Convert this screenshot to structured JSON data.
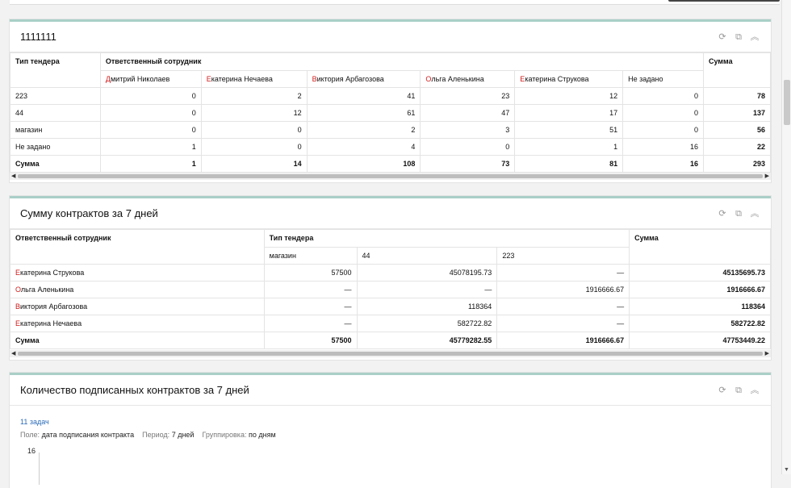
{
  "widget1": {
    "title": "1111111",
    "header": {
      "col1": "Тип тендера",
      "group": "Ответственный сотрудник",
      "sum": "Сумма"
    },
    "employees": [
      {
        "first": "Д",
        "rest": "митрий Николаев"
      },
      {
        "first": "Е",
        "rest": "катерина Нечаева"
      },
      {
        "first": "В",
        "rest": "иктория Арбагозова"
      },
      {
        "first": "О",
        "rest": "льга Аленькина"
      },
      {
        "first": "Е",
        "rest": "катерина Струкова"
      },
      {
        "first": "",
        "rest": "Не задано"
      }
    ],
    "rows": [
      {
        "label": "223",
        "values": [
          "0",
          "2",
          "41",
          "23",
          "12",
          "0"
        ],
        "sum": "78"
      },
      {
        "label": "44",
        "values": [
          "0",
          "12",
          "61",
          "47",
          "17",
          "0"
        ],
        "sum": "137"
      },
      {
        "label": "магазин",
        "values": [
          "0",
          "0",
          "2",
          "3",
          "51",
          "0"
        ],
        "sum": "56"
      },
      {
        "label": "Не задано",
        "values": [
          "1",
          "0",
          "4",
          "0",
          "1",
          "16"
        ],
        "sum": "22"
      },
      {
        "label": "Сумма",
        "values": [
          "1",
          "14",
          "108",
          "73",
          "81",
          "16"
        ],
        "sum": "293"
      }
    ]
  },
  "widget2": {
    "title": "Сумму контрактов за 7 дней",
    "header": {
      "col1": "Ответственный сотрудник",
      "group": "Тип тендера",
      "sum": "Сумма"
    },
    "types": [
      "магазин",
      "44",
      "223"
    ],
    "rows": [
      {
        "first": "Е",
        "rest": "катерина Струкова",
        "values": [
          "57500",
          "45078195.73",
          "—"
        ],
        "sum": "45135695.73"
      },
      {
        "first": "О",
        "rest": "льга Аленькина",
        "values": [
          "—",
          "—",
          "1916666.67"
        ],
        "sum": "1916666.67"
      },
      {
        "first": "В",
        "rest": "иктория Арбагозова",
        "values": [
          "—",
          "118364",
          "—"
        ],
        "sum": "118364"
      },
      {
        "first": "Е",
        "rest": "катерина Нечаева",
        "values": [
          "—",
          "582722.82",
          "—"
        ],
        "sum": "582722.82"
      }
    ],
    "total": {
      "label": "Сумма",
      "values": [
        "57500",
        "45779282.55",
        "1916666.67"
      ],
      "sum": "47753449.22"
    }
  },
  "widget3": {
    "title": "Количество подписанных контрактов за 7 дней",
    "tasks_link": "11 задач",
    "field_label": "Поле:",
    "field_value": "дата подписания контракта",
    "period_label": "Период:",
    "period_value": "7 дней",
    "group_label": "Группировка:",
    "group_value": "по дням",
    "y_top": "16"
  },
  "icons": [
    "refresh-icon",
    "external-link-icon",
    "collapse-icon"
  ]
}
